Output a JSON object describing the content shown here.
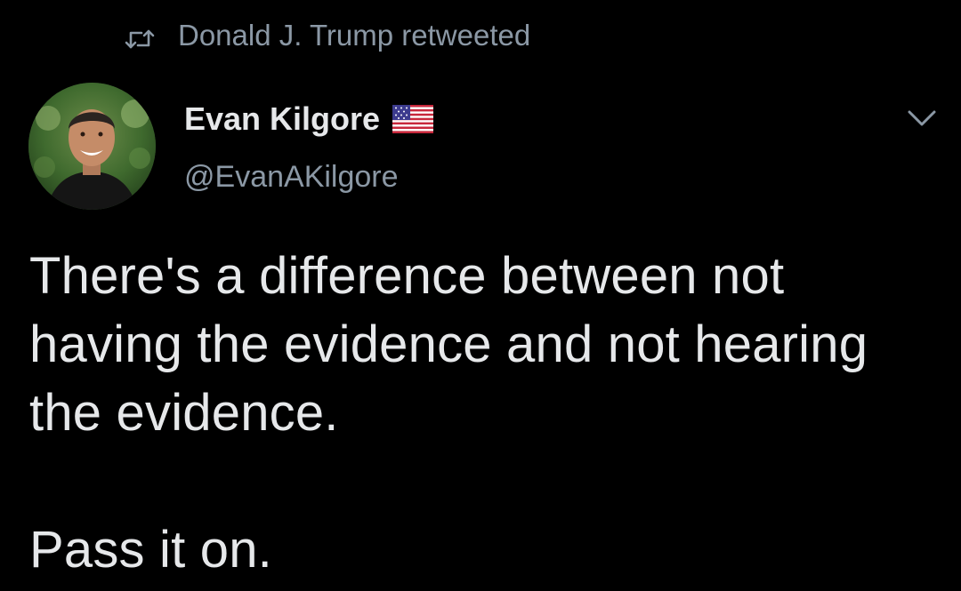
{
  "retweet": {
    "icon": "retweet-icon",
    "text": "Donald J. Trump retweeted"
  },
  "author": {
    "avatar_icon": "avatar",
    "display_name": "Evan Kilgore",
    "badge_icon": "us-flag-icon",
    "handle": "@EvanAKilgore"
  },
  "menu": {
    "icon": "chevron-down-icon"
  },
  "tweet": {
    "text": "There's a difference between not having the evidence and not hearing the evidence.\n\nPass it on."
  },
  "colors": {
    "background": "#000000",
    "primary_text": "#e6e8ea",
    "secondary_text": "#8b98a5"
  }
}
